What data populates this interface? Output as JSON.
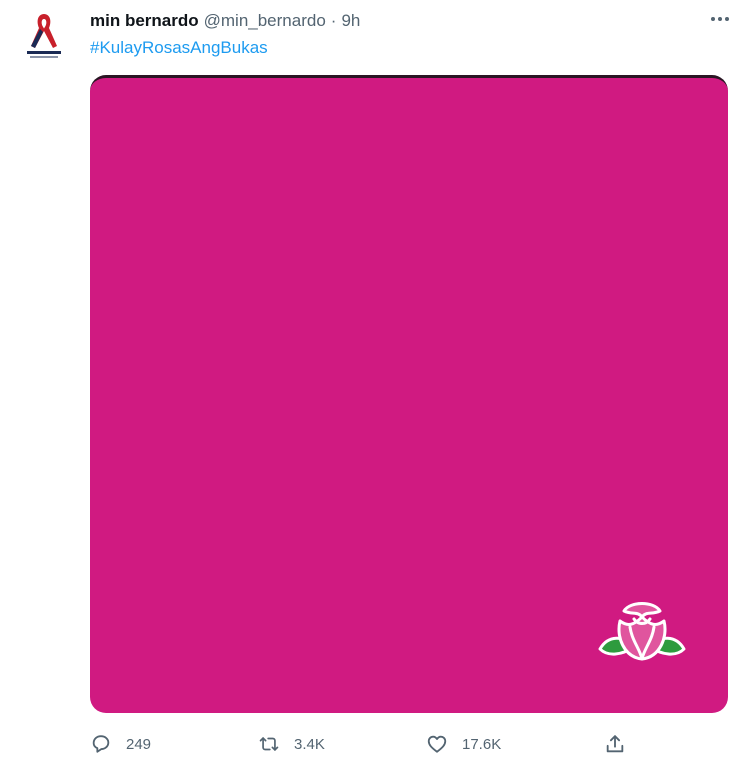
{
  "tweet": {
    "display_name": "min bernardo",
    "handle": "@min_bernardo",
    "separator": "·",
    "time": "9h",
    "text": "#KulayRosasAngBukas",
    "media_color": "#d01a81",
    "actions": {
      "reply_count": "249",
      "retweet_count": "3.4K",
      "like_count": "17.6K"
    }
  },
  "icons": {
    "avatar": "red-ribbon-logo",
    "more": "more-dots-icon",
    "reply": "reply-icon",
    "retweet": "retweet-icon",
    "like": "heart-icon",
    "share": "share-icon",
    "media": "pink-rose-icon"
  },
  "colors": {
    "link": "#1d9bf0",
    "secondary_text": "#536471",
    "primary_text": "#0f1419"
  }
}
